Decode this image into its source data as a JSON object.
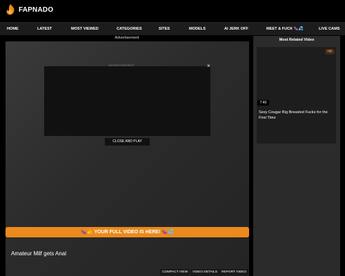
{
  "brand": {
    "name": "FAPNADO",
    "accent": "#ec8a1b"
  },
  "nav": {
    "items": [
      {
        "label": "HOME",
        "icon": ""
      },
      {
        "label": "LATEST",
        "icon": ""
      },
      {
        "label": "MOST VIEWED",
        "icon": ""
      },
      {
        "label": "CATEGORIES",
        "icon": ""
      },
      {
        "label": "SITES",
        "icon": ""
      },
      {
        "label": "MODELS",
        "icon": ""
      },
      {
        "label": "AI JERK OFF",
        "icon": ""
      },
      {
        "label": "MEET & FUCK 🍆💦",
        "icon": ""
      },
      {
        "label": "LIVE CAMS",
        "icon": ""
      }
    ]
  },
  "ad": {
    "top_label": "Advertisement",
    "box_label": "ADVERTISEMENT",
    "close_symbol": "×",
    "close_and_play": "CLOSE AND PLAY"
  },
  "player": {
    "full_video_banner": "🍆👍 YOUR FULL VIDEO IS HERE! 🍆💦",
    "title": "Amateur Milf gets Anal",
    "actions": [
      "COMPACT VIEW",
      "VIDEO DETAILS",
      "REPORT VIDEO"
    ]
  },
  "sidebar": {
    "heading": "Most Related Video",
    "items": [
      {
        "badge": "HD",
        "duration": "7:40",
        "title": "Sexy Cougar Big Breasted Fucks for the First Time"
      }
    ]
  }
}
